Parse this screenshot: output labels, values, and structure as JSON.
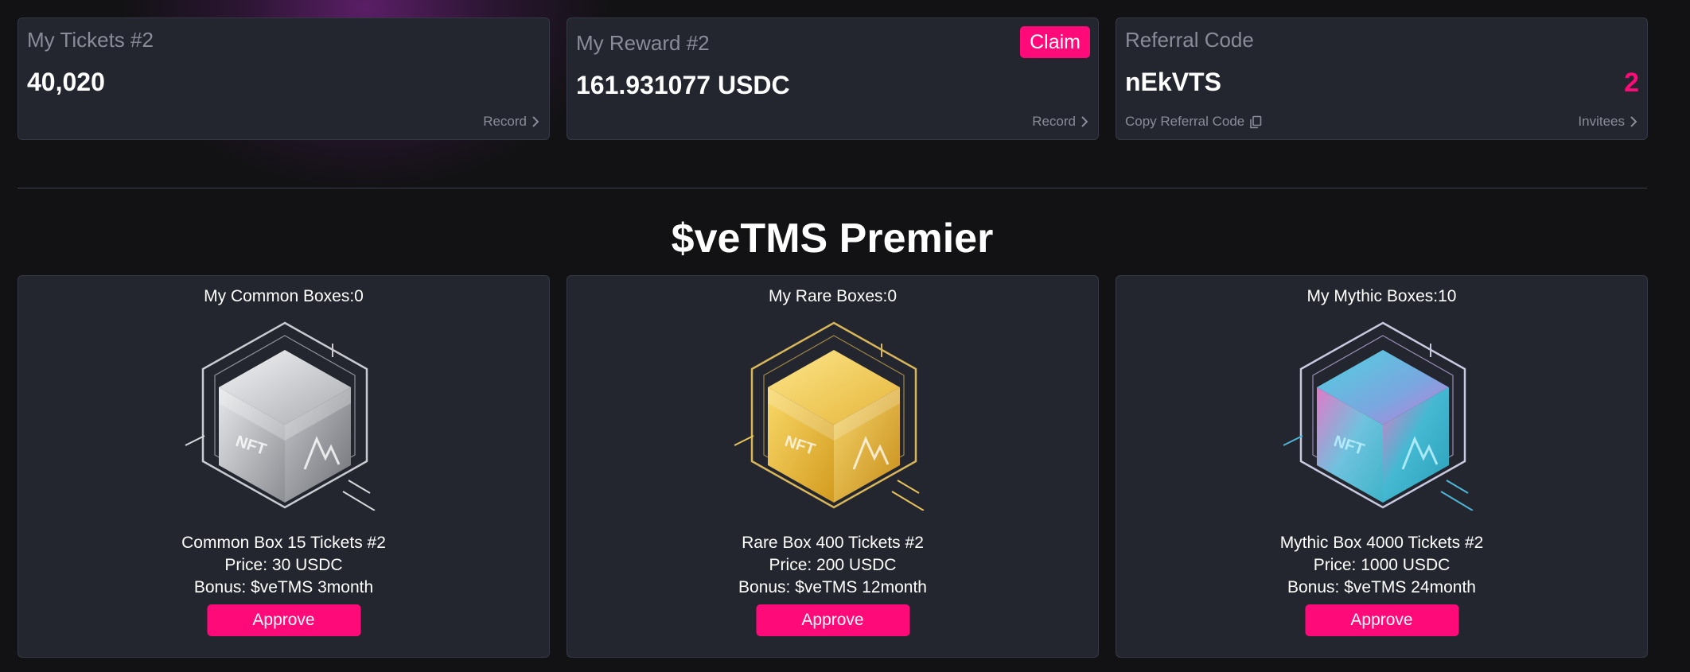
{
  "tickets": {
    "title": "My Tickets #2",
    "value": "40,020",
    "record_label": "Record"
  },
  "reward": {
    "title": "My Reward #2",
    "value": "161.931077 USDC",
    "claim_label": "Claim",
    "record_label": "Record"
  },
  "referral": {
    "title": "Referral Code",
    "code": "nEkVTS",
    "invitee_count": "2",
    "copy_label": "Copy Referral Code",
    "invitees_label": "Invitees"
  },
  "section": {
    "title": "$veTMS Premier"
  },
  "boxes": [
    {
      "count": "My Common Boxes:0",
      "name": "Common Box 15 Tickets #2",
      "price": "Price: 30 USDC",
      "bonus": "Bonus: $veTMS 3month",
      "approve_label": "Approve"
    },
    {
      "count": "My Rare Boxes:0",
      "name": "Rare Box 400 Tickets #2",
      "price": "Price: 200 USDC",
      "bonus": "Bonus: $veTMS 12month",
      "approve_label": "Approve"
    },
    {
      "count": "My Mythic Boxes:10",
      "name": "Mythic Box 4000 Tickets #2",
      "price": "Price: 1000 USDC",
      "bonus": "Bonus: $veTMS 24month",
      "approve_label": "Approve"
    }
  ],
  "colors": {
    "accent": "#ff0a78",
    "card": "#23252f",
    "background": "#121214",
    "muted": "#8a8d99"
  }
}
